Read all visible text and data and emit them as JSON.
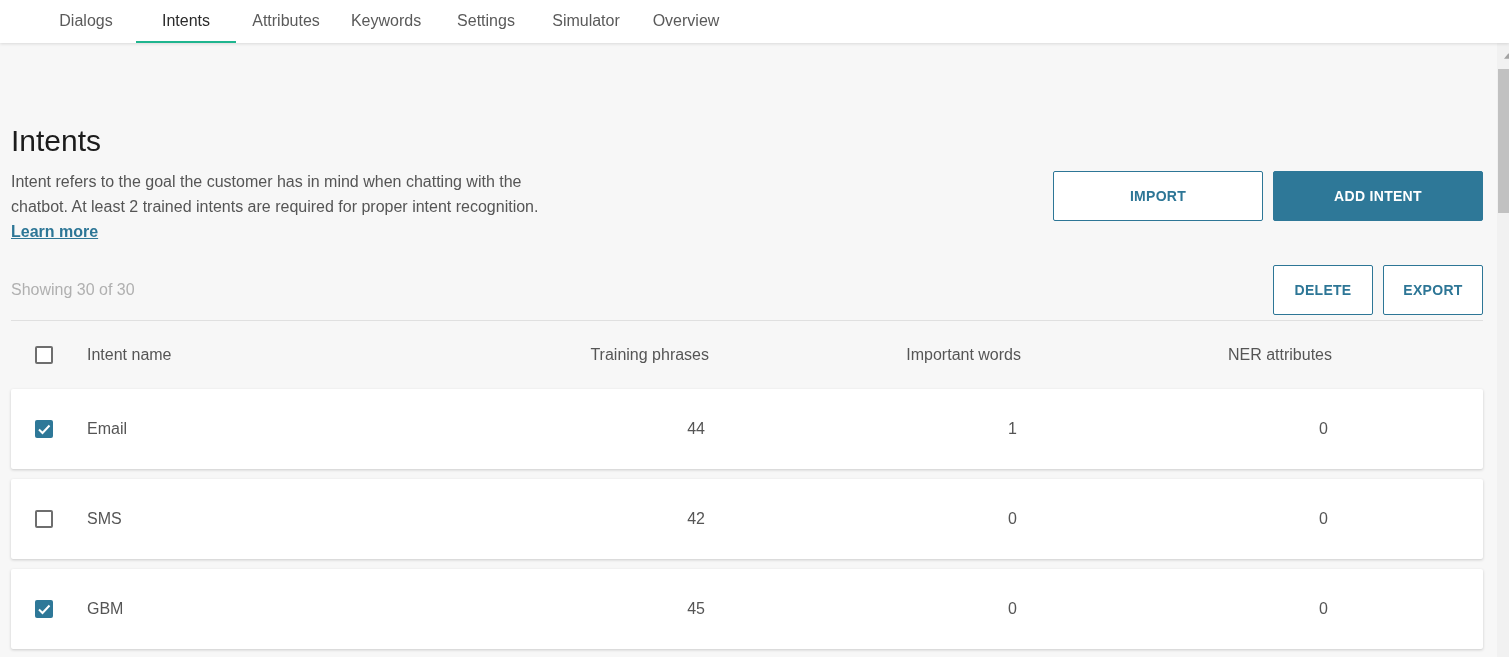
{
  "tabs": [
    {
      "label": "Dialogs",
      "selected": false
    },
    {
      "label": "Intents",
      "selected": true
    },
    {
      "label": "Attributes",
      "selected": false
    },
    {
      "label": "Keywords",
      "selected": false
    },
    {
      "label": "Settings",
      "selected": false
    },
    {
      "label": "Simulator",
      "selected": false
    },
    {
      "label": "Overview",
      "selected": false
    }
  ],
  "page_title": "Intents",
  "description": {
    "text": "Intent refers to the goal the customer has in mind when chatting with the chatbot. At least 2 trained intents are required for proper intent recognition.",
    "link": "Learn more"
  },
  "header_buttons": [
    {
      "label": "IMPORT",
      "kind": "outline"
    },
    {
      "label": "ADD INTENT",
      "kind": "primary"
    }
  ],
  "showing": "Showing 30 of 30",
  "table_buttons": [
    {
      "label": "DELETE",
      "kind": "outline"
    },
    {
      "label": "EXPORT",
      "kind": "outline"
    }
  ],
  "table": {
    "select_all_checked": false,
    "columns": [
      "Intent name",
      "Training phrases",
      "Important words",
      "NER attributes"
    ],
    "rows": [
      {
        "checked": true,
        "cells": [
          "Email",
          "44",
          "1",
          "0"
        ]
      },
      {
        "checked": false,
        "cells": [
          "SMS",
          "42",
          "0",
          "0"
        ]
      },
      {
        "checked": true,
        "cells": [
          "GBM",
          "45",
          "0",
          "0"
        ]
      }
    ]
  }
}
